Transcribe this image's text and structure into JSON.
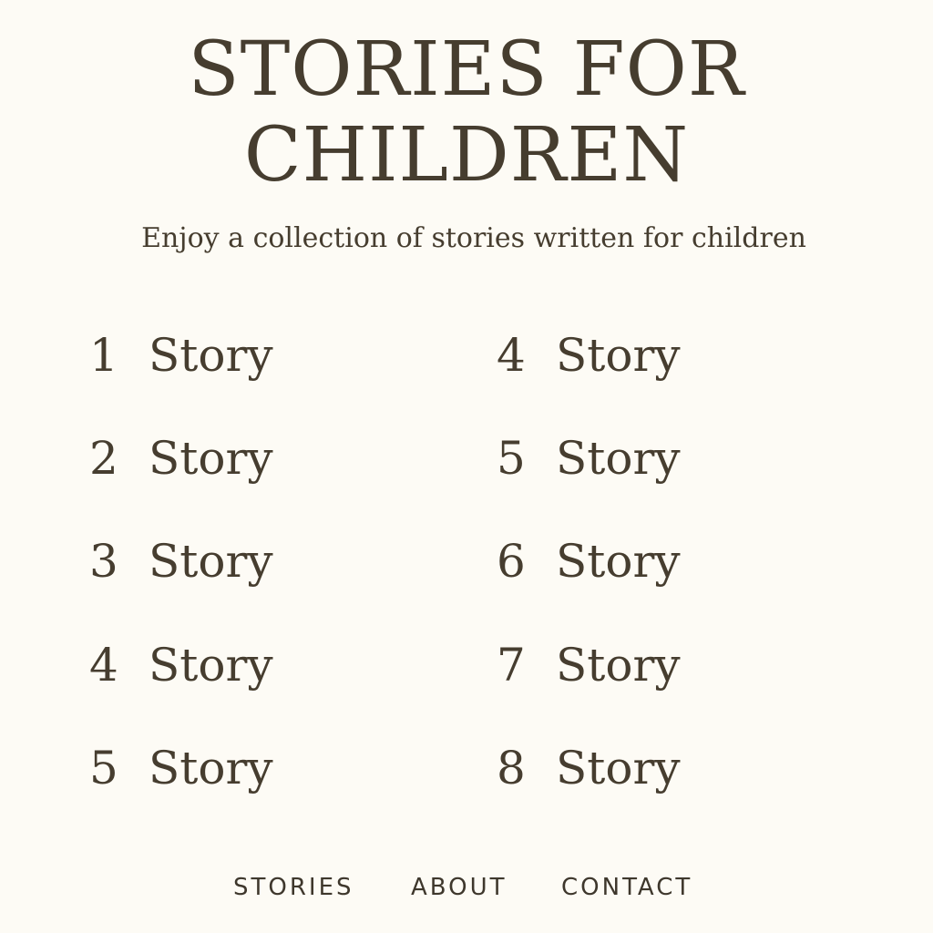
{
  "header": {
    "title_line1": "STORIES FOR",
    "title_line2": "CHILDREN",
    "subtitle": "Enjoy a collection of stories written for children"
  },
  "stories": [
    {
      "number": "1",
      "label": "Story"
    },
    {
      "number": "2",
      "label": "Story"
    },
    {
      "number": "3",
      "label": "Story"
    },
    {
      "number": "4",
      "label": "Story"
    },
    {
      "number": "5",
      "label": "Story"
    },
    {
      "number": "4",
      "label": "Story"
    },
    {
      "number": "5",
      "label": "Story"
    },
    {
      "number": "6",
      "label": "Story"
    },
    {
      "number": "7",
      "label": "Story"
    },
    {
      "number": "8",
      "label": "Story"
    }
  ],
  "nav": {
    "items": [
      "STORIES",
      "ABOUT",
      "CONTACT"
    ]
  },
  "colors": {
    "background": "#fdfbf5",
    "text": "#463d2f"
  }
}
